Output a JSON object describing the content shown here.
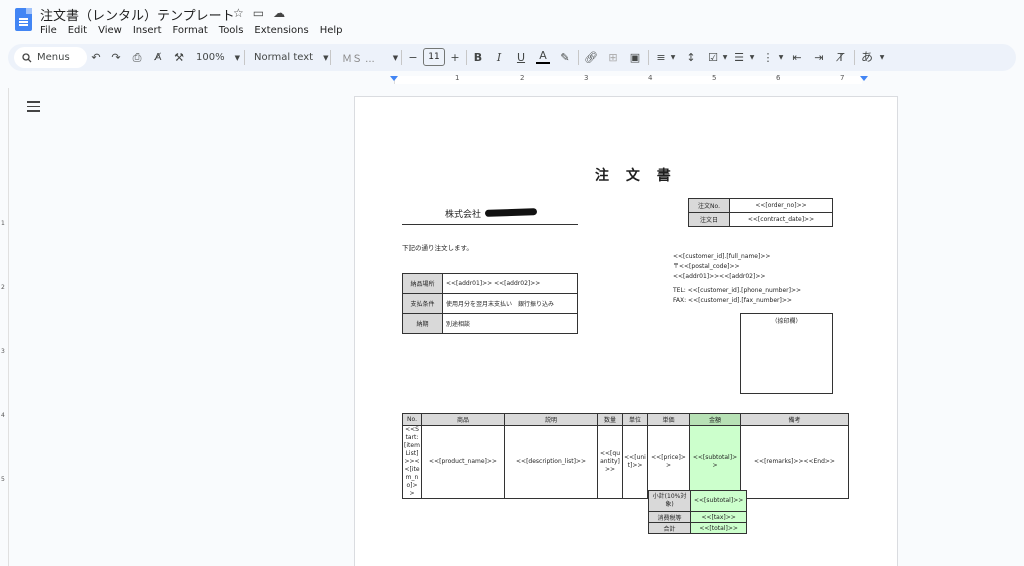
{
  "app": {
    "title": "注文書（レンタル）テンプレート",
    "menu": [
      "File",
      "Edit",
      "View",
      "Insert",
      "Format",
      "Tools",
      "Extensions",
      "Help"
    ]
  },
  "toolbar": {
    "menus_label": "Menus",
    "zoom": "100%",
    "style": "Normal text",
    "font": "ＭＳ ...",
    "font_size": "11",
    "input_tools": "あ"
  },
  "ruler": {
    "numbers": [
      "1",
      "2",
      "3",
      "4",
      "5",
      "6",
      "7"
    ],
    "vnumbers": [
      "1",
      "2",
      "3",
      "4",
      "5"
    ]
  },
  "doc": {
    "heading": "注 文 書",
    "company": "株式会社",
    "intro": "下記の通り注文します。",
    "order_table": [
      {
        "label": "注文No.",
        "value": "<<[order_no]>>"
      },
      {
        "label": "注文日",
        "value": "<<[contract_date]>>"
      }
    ],
    "customer": {
      "name": "<<[customer_id].[full_name]>>",
      "postal": "〒<<[postal_code]>>",
      "addr": "<<[addr01]>><<[addr02]>>",
      "tel": "TEL: <<[customer_id].[phone_number]>>",
      "fax": "FAX: <<[customer_id].[fax_number]>>"
    },
    "delivery_table": [
      {
        "label": "納品場所",
        "value": "<<[addr01]>> <<[addr02]>>"
      },
      {
        "label": "支払条件",
        "value": "使用月分を翌月末支払い　銀行振り込み"
      },
      {
        "label": "納期",
        "value": "別途相談"
      }
    ],
    "stamp_label": "（捺印欄）",
    "items_table": {
      "headers": [
        "No.",
        "商品",
        "説明",
        "数量",
        "単位",
        "単価",
        "金額",
        "備考"
      ],
      "row": [
        "<<Start:[item List]>><<[item_no]>>",
        "<<[product_name]>>",
        "<<[description_list]>>",
        "<<[quantity]>>",
        "<<[unit]>>",
        "<<[price]>>",
        "<<[subtotal]>>",
        "<<[remarks]>><<End>>"
      ]
    },
    "summary": [
      {
        "label": "小計(10%対象)",
        "value": "<<[subtotal]>>"
      },
      {
        "label": "消費税等",
        "value": "<<[tax]>>"
      },
      {
        "label": "合計",
        "value": "<<[total]>>"
      }
    ]
  }
}
